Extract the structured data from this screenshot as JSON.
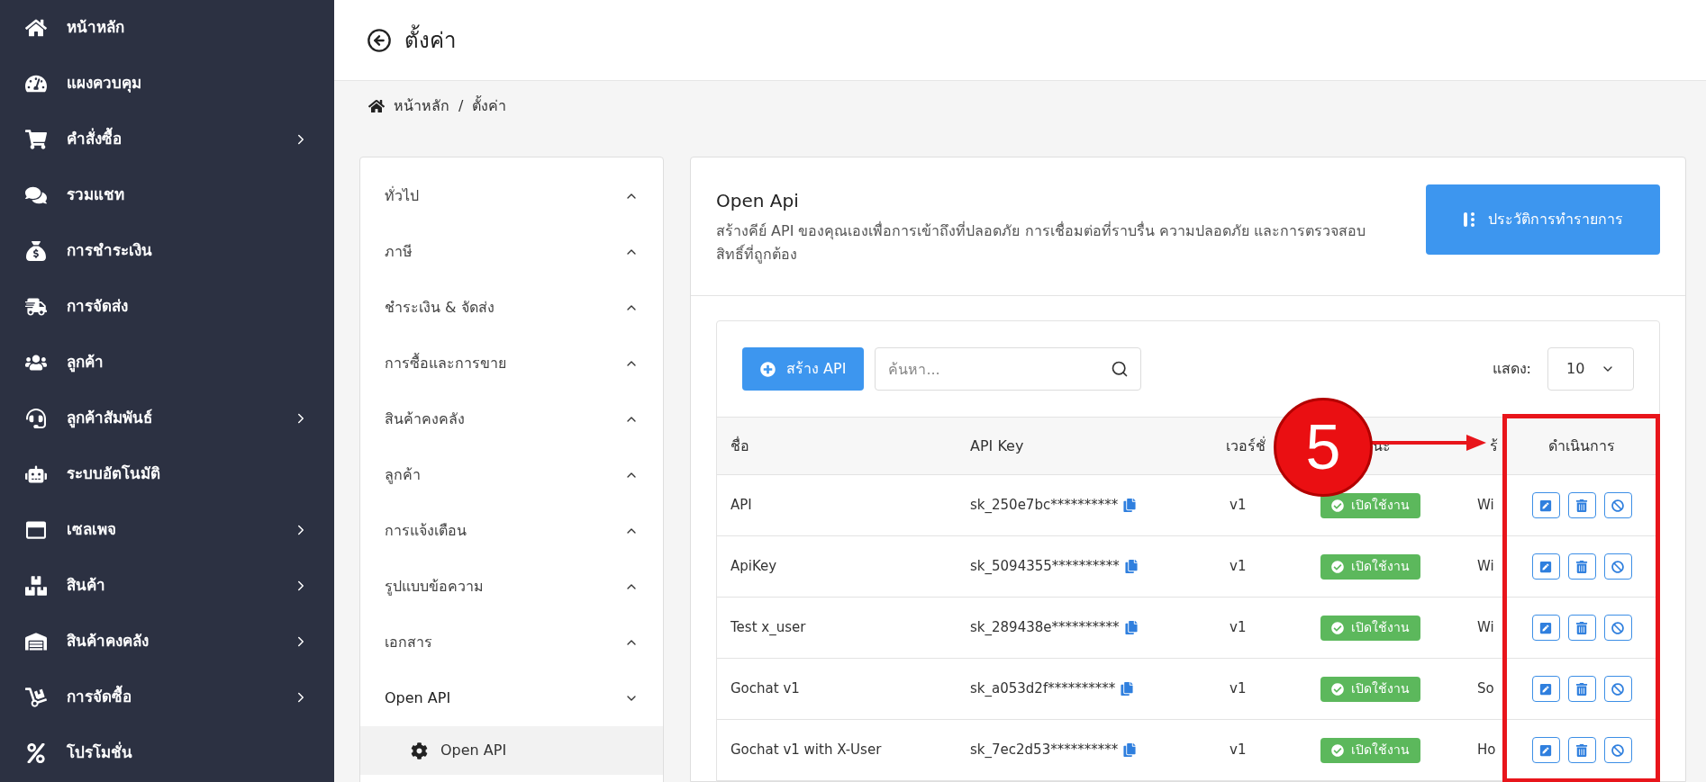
{
  "sidebar": {
    "items": [
      {
        "label": "หน้าหลัก",
        "has_submenu": false
      },
      {
        "label": "แผงควบคุม",
        "has_submenu": false
      },
      {
        "label": "คำสั่งซื้อ",
        "has_submenu": true
      },
      {
        "label": "รวมแชท",
        "has_submenu": false
      },
      {
        "label": "การชำระเงิน",
        "has_submenu": false
      },
      {
        "label": "การจัดส่ง",
        "has_submenu": false
      },
      {
        "label": "ลูกค้า",
        "has_submenu": false
      },
      {
        "label": "ลูกค้าสัมพันธ์",
        "has_submenu": true
      },
      {
        "label": "ระบบอัตโนมัติ",
        "has_submenu": false
      },
      {
        "label": "เซลเพจ",
        "has_submenu": true
      },
      {
        "label": "สินค้า",
        "has_submenu": true
      },
      {
        "label": "สินค้าคงคลัง",
        "has_submenu": true
      },
      {
        "label": "การจัดซื้อ",
        "has_submenu": true
      },
      {
        "label": "โปรโมชั่น",
        "has_submenu": false
      }
    ]
  },
  "header": {
    "title": "ตั้งค่า"
  },
  "breadcrumb": {
    "items": [
      "หน้าหลัก",
      "ตั้งค่า"
    ],
    "separator": "/"
  },
  "settings_menu": {
    "items": [
      {
        "label": "ทั่วไป",
        "expanded": false
      },
      {
        "label": "ภาษี",
        "expanded": false
      },
      {
        "label": "ชำระเงิน & จัดส่ง",
        "expanded": false
      },
      {
        "label": "การซื้อและการขาย",
        "expanded": false
      },
      {
        "label": "สินค้าคงคลัง",
        "expanded": false
      },
      {
        "label": "ลูกค้า",
        "expanded": false
      },
      {
        "label": "การแจ้งเตือน",
        "expanded": false
      },
      {
        "label": "รูปแบบข้อความ",
        "expanded": false
      },
      {
        "label": "เอกสาร",
        "expanded": false
      },
      {
        "label": "Open API",
        "expanded": true,
        "children": [
          {
            "label": "Open API",
            "selected": true
          }
        ]
      }
    ]
  },
  "panel": {
    "title": "Open Api",
    "description": "สร้างคีย์ API ของคุณเองเพื่อการเข้าถึงที่ปลอดภัย การเชื่อมต่อที่ราบรื่น ความปลอดภัย และการตรวจสอบสิทธิ์ที่ถูกต้อง",
    "history_button": "ประวัติการทำรายการ"
  },
  "toolbar": {
    "create_button": "สร้าง API",
    "search": {
      "placeholder": "ค้นหา..."
    },
    "page_size": {
      "label": "แสดง:",
      "value": "10"
    }
  },
  "table": {
    "columns": [
      "ชื่อ",
      "API Key",
      "เวอร์ชั่",
      "นะ",
      "ร้",
      "ดำเนินการ"
    ],
    "rows": [
      {
        "name": "API",
        "api_key": "sk_250e7bc**********",
        "version": "v1",
        "status": {
          "label": "เปิดใช้งาน",
          "enabled": true
        },
        "column_5": "Wi"
      },
      {
        "name": "ApiKey",
        "api_key": "sk_5094355**********",
        "version": "v1",
        "status": {
          "label": "เปิดใช้งาน",
          "enabled": true
        },
        "column_5": "Wi"
      },
      {
        "name": "Test x_user",
        "api_key": "sk_289438e**********",
        "version": "v1",
        "status": {
          "label": "เปิดใช้งาน",
          "enabled": true
        },
        "column_5": "Wi"
      },
      {
        "name": "Gochat v1",
        "api_key": "sk_a053d2f**********",
        "version": "v1",
        "status": {
          "label": "เปิดใช้งาน",
          "enabled": true
        },
        "column_5": "So"
      },
      {
        "name": "Gochat v1 with X-User",
        "api_key": "sk_7ec2d53**********",
        "version": "v1",
        "status": {
          "label": "เปิดใช้งาน",
          "enabled": true
        },
        "column_5": "Ho"
      }
    ]
  },
  "annotation": {
    "number": "5"
  }
}
